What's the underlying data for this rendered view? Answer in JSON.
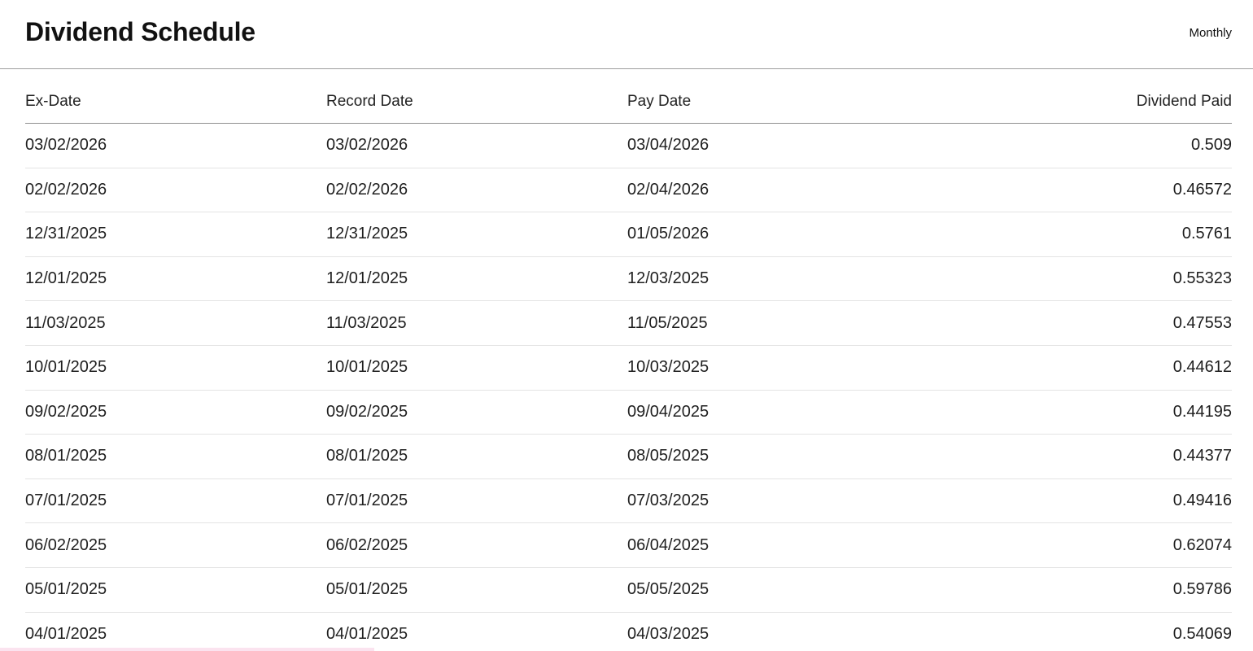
{
  "header": {
    "title": "Dividend Schedule",
    "frequency": "Monthly"
  },
  "table": {
    "columns": [
      "Ex-Date",
      "Record Date",
      "Pay Date",
      "Dividend Paid"
    ],
    "rows": [
      [
        "03/02/2026",
        "03/02/2026",
        "03/04/2026",
        "0.509"
      ],
      [
        "02/02/2026",
        "02/02/2026",
        "02/04/2026",
        "0.46572"
      ],
      [
        "12/31/2025",
        "12/31/2025",
        "01/05/2026",
        "0.5761"
      ],
      [
        "12/01/2025",
        "12/01/2025",
        "12/03/2025",
        "0.55323"
      ],
      [
        "11/03/2025",
        "11/03/2025",
        "11/05/2025",
        "0.47553"
      ],
      [
        "10/01/2025",
        "10/01/2025",
        "10/03/2025",
        "0.44612"
      ],
      [
        "09/02/2025",
        "09/02/2025",
        "09/04/2025",
        "0.44195"
      ],
      [
        "08/01/2025",
        "08/01/2025",
        "08/05/2025",
        "0.44377"
      ],
      [
        "07/01/2025",
        "07/01/2025",
        "07/03/2025",
        "0.49416"
      ],
      [
        "06/02/2025",
        "06/02/2025",
        "06/04/2025",
        "0.62074"
      ],
      [
        "05/01/2025",
        "05/01/2025",
        "05/05/2025",
        "0.59786"
      ],
      [
        "04/01/2025",
        "04/01/2025",
        "04/03/2025",
        "0.54069"
      ]
    ]
  }
}
